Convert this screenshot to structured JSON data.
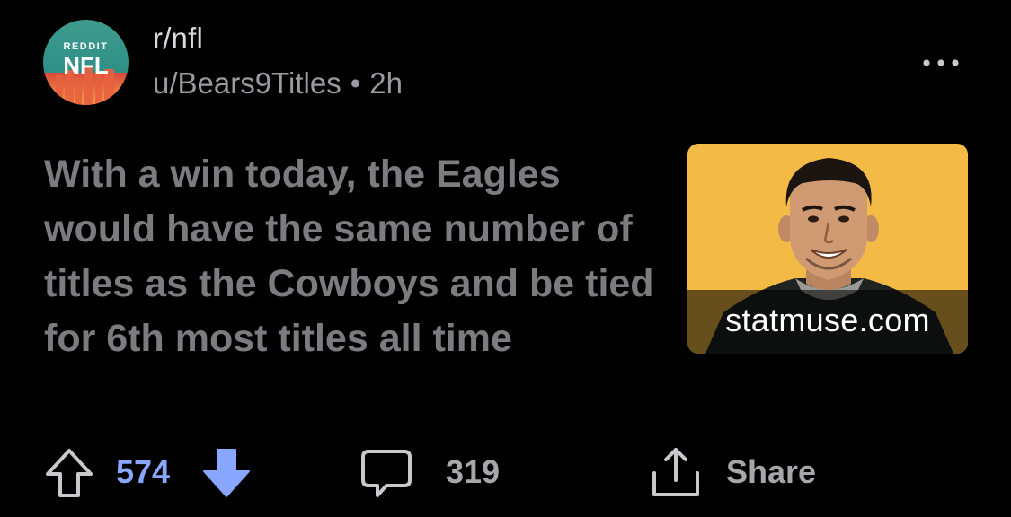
{
  "post": {
    "subreddit": "r/nfl",
    "author": "u/Bears9Titles",
    "separator": "•",
    "age": "2h",
    "title": "With a win today, the Eagles would have the same number of titles as the Cowboys and be tied for 6th most titles all time"
  },
  "avatar": {
    "top_text": "REDDIT",
    "main_text": "NFL"
  },
  "thumbnail": {
    "domain": "statmuse.com",
    "background_color": "#f3bb45"
  },
  "actions": {
    "score": "574",
    "comments": "319",
    "share_label": "Share"
  },
  "colors": {
    "upvote_accent": "#8aa7ff",
    "background": "#000000"
  },
  "icons": {
    "menu": "more-horizontal-icon",
    "upvote": "arrow-up-outline-icon",
    "downvote": "arrow-down-filled-icon",
    "comment": "speech-bubble-icon",
    "share": "share-upload-icon"
  }
}
